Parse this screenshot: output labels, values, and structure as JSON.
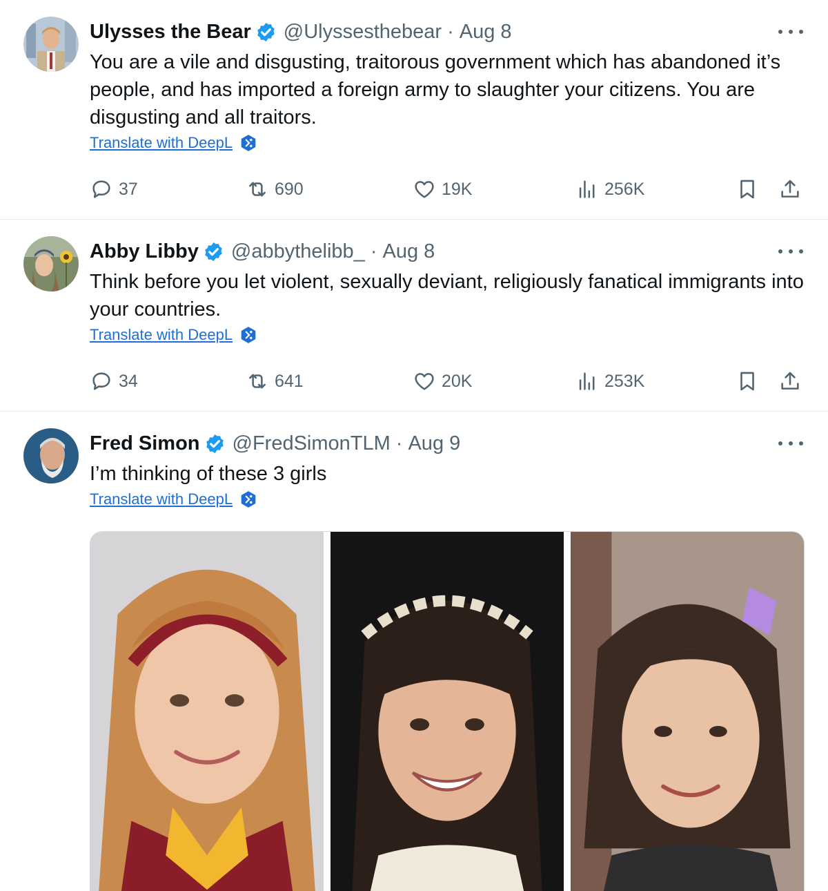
{
  "tweets": [
    {
      "name": "Ulysses the Bear",
      "handle": "@Ulyssesthebear",
      "separator": "·",
      "date": "Aug 8",
      "text": "You are a vile and disgusting, traitorous government which has abandoned it’s people, and has imported a foreign army to slaughter your citizens. You are disgusting and all traitors.",
      "translate_label": "Translate with DeepL",
      "replies": "37",
      "retweets": "690",
      "likes": "19K",
      "views": "256K"
    },
    {
      "name": "Abby Libby",
      "handle": "@abbythelibb_",
      "separator": "·",
      "date": "Aug 8",
      "text": "Think before you let violent, sexually deviant, religiously fanatical immigrants into your countries.",
      "translate_label": "Translate with DeepL",
      "replies": "34",
      "retweets": "641",
      "likes": "20K",
      "views": "253K"
    },
    {
      "name": "Fred Simon",
      "handle": "@FredSimonTLM",
      "separator": "·",
      "date": "Aug 9",
      "text": "I’m thinking of these 3 girls",
      "translate_label": "Translate with DeepL"
    }
  ],
  "icons": {
    "verified": "verified-badge-icon",
    "more": "more-options-icon",
    "translate": "deepl-icon",
    "reply": "reply-icon",
    "retweet": "retweet-icon",
    "like": "heart-icon",
    "views": "views-chart-icon",
    "bookmark": "bookmark-icon",
    "share": "share-icon"
  },
  "colors": {
    "text": "#0f1419",
    "secondary": "#536471",
    "verified": "#1d9bf0",
    "link": "#1d6fd6",
    "divider": "#e6e9eb"
  }
}
